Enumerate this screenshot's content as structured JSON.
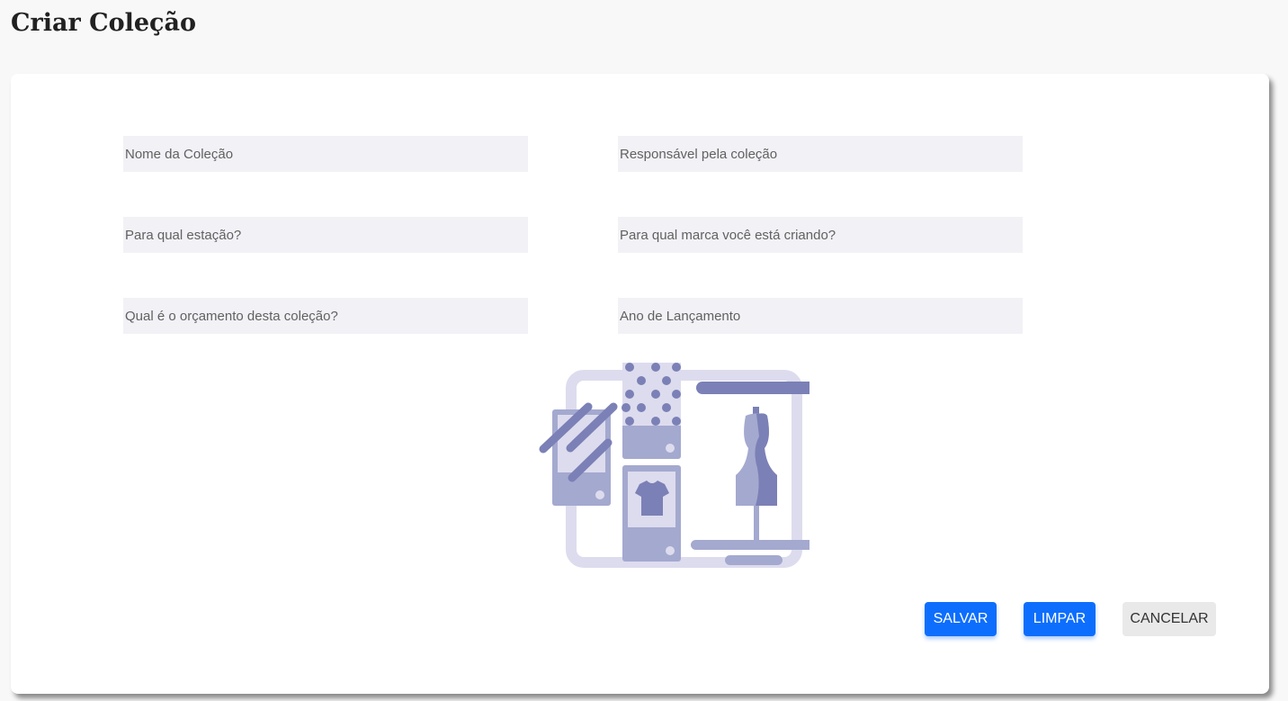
{
  "page": {
    "title": "Criar Coleção"
  },
  "form": {
    "collection_name": {
      "placeholder": "Nome da Coleção",
      "value": ""
    },
    "owner": {
      "placeholder": "Responsável pela coleção",
      "value": ""
    },
    "season": {
      "placeholder": "Para qual estação?",
      "value": ""
    },
    "brand": {
      "placeholder": "Para qual marca você está criando?",
      "value": ""
    },
    "budget": {
      "placeholder": "Qual é o orçamento desta coleção?",
      "value": ""
    },
    "launch_year": {
      "placeholder": "Ano de Lançamento",
      "value": ""
    }
  },
  "actions": {
    "save_label": "SALVAR",
    "clear_label": "LIMPAR",
    "cancel_label": "CANCELAR"
  },
  "illustration": {
    "icon": "fashion-collection-illustration"
  },
  "colors": {
    "primary": "#0d6efd",
    "field_bg": "#f2f1f6",
    "secondary_button": "#e9e9e9",
    "illustration_light": "#dddcee",
    "illustration_mid": "#a4a9cf",
    "illustration_dark": "#7b80b6"
  }
}
